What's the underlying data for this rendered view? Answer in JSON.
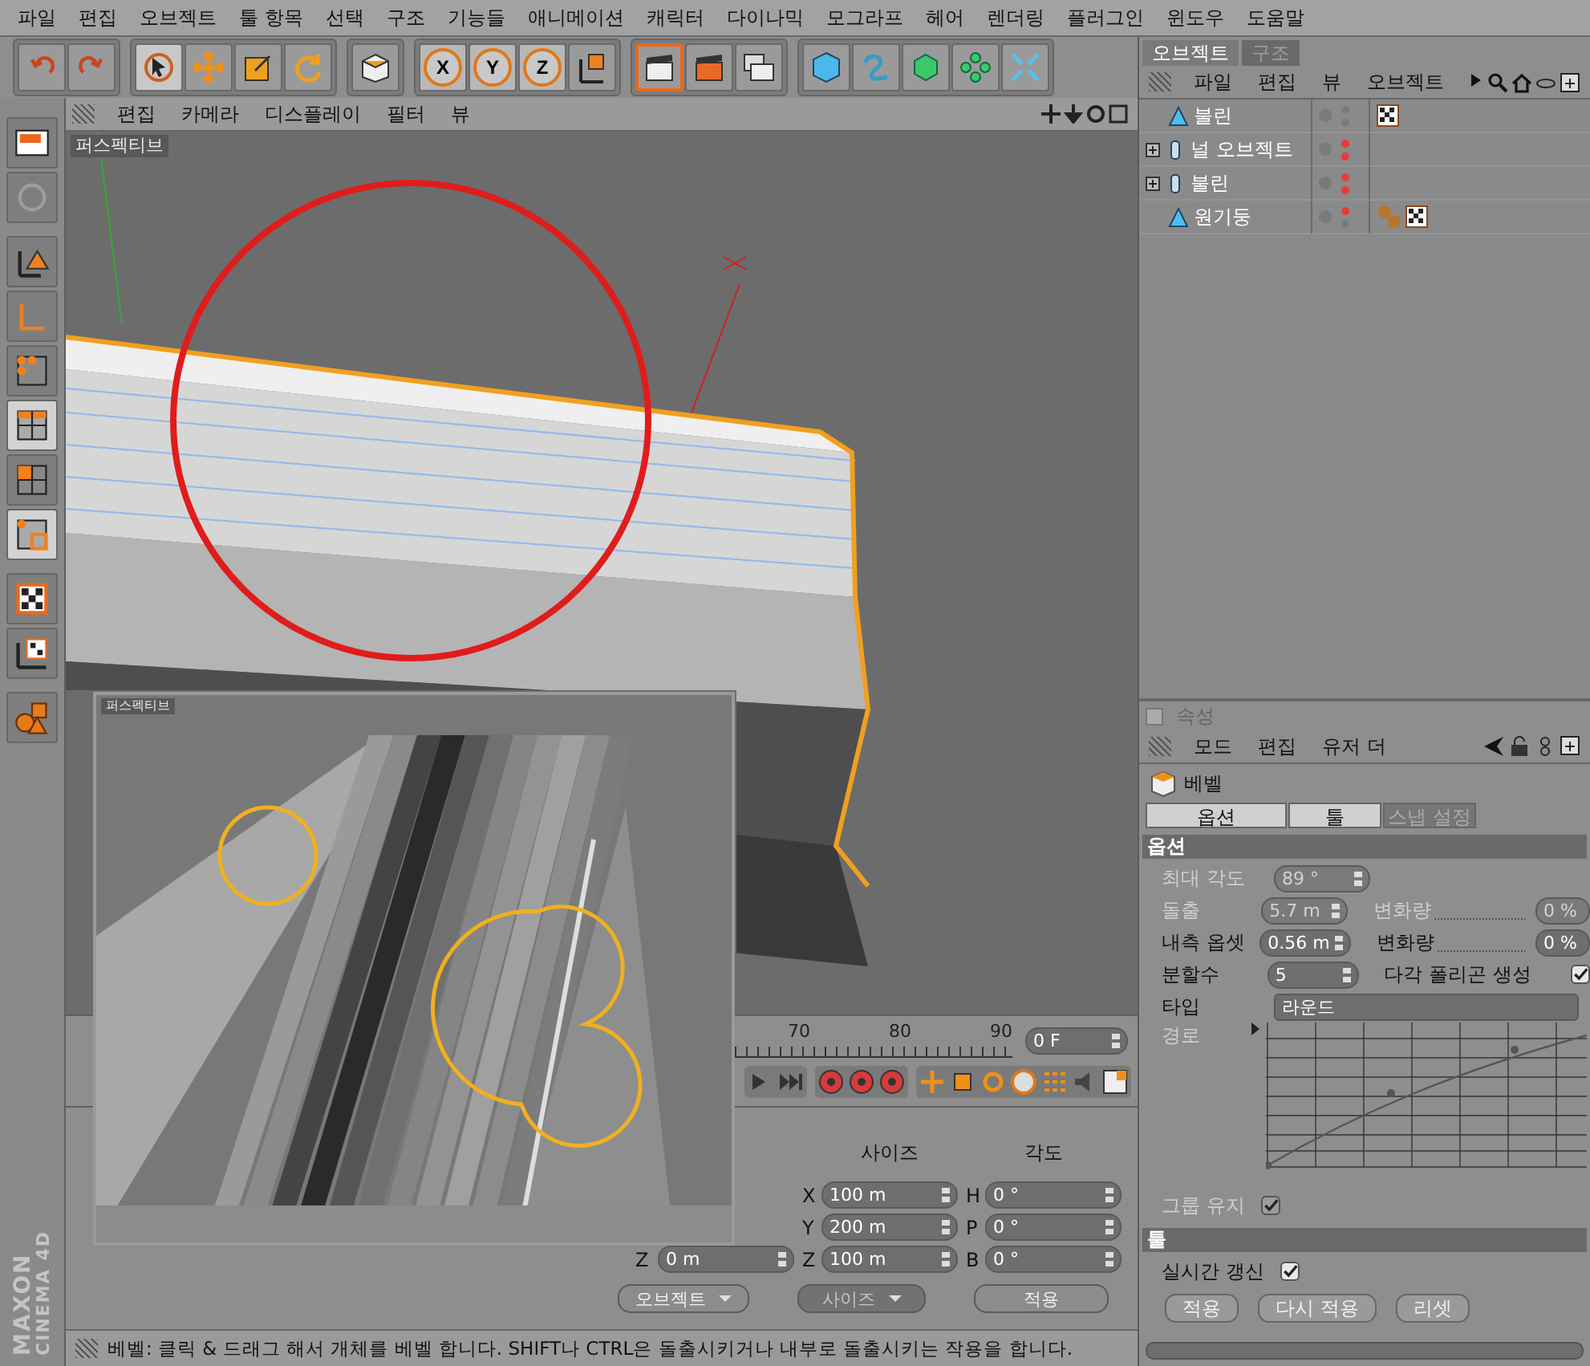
{
  "menu_bar": {
    "items": [
      "파일",
      "편집",
      "오브젝트",
      "툴 항목",
      "선택",
      "구조",
      "기능들",
      "애니메이션",
      "캐릭터",
      "다이나믹",
      "모그라프",
      "헤어",
      "렌더링",
      "플러그인",
      "윈도우",
      "도움말"
    ]
  },
  "axis_lock": [
    {
      "label": "X",
      "on": true
    },
    {
      "label": "Y",
      "on": true
    },
    {
      "label": "Z",
      "on": true
    }
  ],
  "left_tools": [
    {
      "selected": false
    },
    {
      "selected": false
    },
    {
      "selected": false
    },
    {
      "selected": false
    },
    {
      "selected": false
    },
    {
      "selected": true
    },
    {
      "selected": false
    },
    {
      "selected": true
    },
    {
      "selected": false
    },
    {
      "selected": false
    },
    {
      "selected": false
    }
  ],
  "viewport": {
    "menu": [
      "편집",
      "카메라",
      "디스플레이",
      "필터",
      "뷰"
    ],
    "camera_label": "퍼스펙티브"
  },
  "inset": {
    "camera_label": "퍼스펙티브"
  },
  "timeline": {
    "ticks": [
      "70",
      "80",
      "90"
    ],
    "frame": "0 F"
  },
  "coordinates": {
    "headers": [
      "사이즈",
      "각도"
    ],
    "rows": [
      {
        "size_axis": "X",
        "size": "100 m",
        "angle_axis": "H",
        "angle": "0 °"
      },
      {
        "size_axis": "Y",
        "size": "200 m",
        "angle_axis": "P",
        "angle": "0 °"
      },
      {
        "position_axis": "Z",
        "position": "0 m",
        "size_axis": "Z",
        "size": "100 m",
        "angle_axis": "B",
        "angle": "0 °"
      }
    ],
    "buttons": [
      {
        "label": "오브젝트",
        "kind": "dropdown",
        "disabled": false
      },
      {
        "label": "사이즈",
        "kind": "dropdown",
        "disabled": true
      },
      {
        "label": "적용",
        "kind": "button",
        "disabled": false
      }
    ]
  },
  "status_bar": "베벨: 클릭 & 드래그 해서 개체를 베벨 합니다. SHIFT나 CTRL은  돌출시키거나 내부로 돌출시키는 작용을 합니다.",
  "logo": [
    "MAXON",
    "CINEMA 4D"
  ],
  "object_manager": {
    "tabs": [
      {
        "label": "오브젝트",
        "selected": true
      },
      {
        "label": "구조",
        "selected": false
      }
    ],
    "menu": [
      "파일",
      "편집",
      "뷰",
      "오브젝트"
    ],
    "objects": [
      {
        "name": "불린",
        "kind": "polygon",
        "dots": [
          {
            "color": "#7a7a7a"
          },
          {
            "color": "#7a7a7a"
          }
        ],
        "tags": [
          {
            "kind": "texture"
          }
        ]
      },
      {
        "name": "널 오브젝트",
        "kind": "group",
        "expanded": false,
        "dots": [
          {
            "color": "#e83a3a"
          },
          {
            "color": "#e83a3a"
          }
        ]
      },
      {
        "name": "불린",
        "kind": "group",
        "expanded": false,
        "dots": [
          {
            "color": "#e83a3a"
          },
          {
            "color": "#e83a3a"
          }
        ]
      },
      {
        "name": "원기둥",
        "kind": "polygon",
        "dots": [
          {
            "color": "#e83a3a"
          },
          {
            "color": "#7a7a7a"
          }
        ],
        "tags": [
          {
            "kind": "material"
          },
          {
            "kind": "texture"
          }
        ]
      }
    ]
  },
  "attributes": {
    "title": "속성",
    "menu": [
      "모드",
      "편집",
      "유저 더"
    ],
    "object": "베벨",
    "tabs": [
      {
        "label": "옵션",
        "selected": true
      },
      {
        "label": "툴",
        "selected": true
      },
      {
        "label": "스냅 설정",
        "selected": false
      }
    ],
    "options_title": "옵션",
    "options_rows": [
      {
        "kind": "field",
        "label": "최대 각도",
        "value": "89 °",
        "disabled": true
      },
      {
        "kind": "pair",
        "label": "돌출",
        "value": "5.7 m",
        "disabled": true,
        "label2": "변화량",
        "value2": "0 %"
      },
      {
        "kind": "pair",
        "label": "내측 옵셋",
        "value": "0.56 m",
        "disabled": false,
        "label2": "변화량",
        "value2": "0 %"
      },
      {
        "kind": "field_check",
        "label": "분할수",
        "value": "5",
        "disabled": false,
        "label2": "다각 폴리곤 생성",
        "checked": true
      },
      {
        "kind": "dropdown",
        "label": "타입",
        "value": "라운드",
        "disabled": false
      },
      {
        "kind": "curve",
        "label": "경로",
        "disabled": true
      },
      {
        "kind": "check",
        "label": "그룹 유지",
        "checked": true,
        "disabled": true
      }
    ],
    "tool_title": "툴",
    "tool_rows": [
      {
        "kind": "check",
        "label": "실시간 갱신",
        "checked": true,
        "disabled": false
      }
    ],
    "buttons": [
      "적용",
      "다시 적용",
      "리셋"
    ]
  }
}
